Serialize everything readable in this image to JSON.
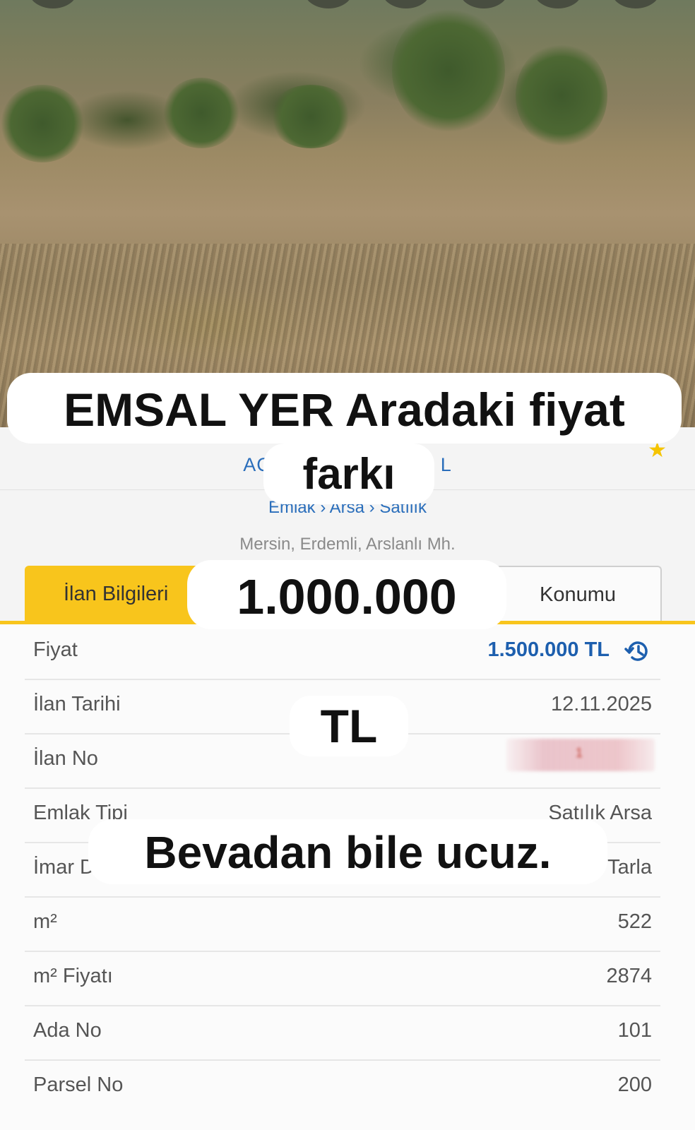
{
  "overlay": {
    "line1": "EMSAL YER Aradaki fiyat",
    "line2": "farkı",
    "line3": "1.000.000",
    "line4": "TL",
    "line5": "Bevadan bile ucuz."
  },
  "header": {
    "title_left": "AC",
    "title_right": "L",
    "star": "★",
    "breadcrumb": "Emlak › Arsa › Satılık",
    "location": "Mersin, Erdemli, Arslanlı Mh."
  },
  "tabs": {
    "info": "İlan Bilgileri",
    "location": "Konumu"
  },
  "rows": [
    {
      "key": "Fiyat",
      "value": "1.500.000 TL"
    },
    {
      "key": "İlan Tarihi",
      "value": "12.11.2025"
    },
    {
      "key": "İlan No",
      "value": "1"
    },
    {
      "key": "Emlak Tipi",
      "value": "Satılık Arsa"
    },
    {
      "key": "İmar Durumu",
      "value": "Tarla"
    },
    {
      "key": "m²",
      "value": "522"
    },
    {
      "key": "m² Fiyatı",
      "value": "2874"
    },
    {
      "key": "Ada No",
      "value": "101"
    },
    {
      "key": "Parsel No",
      "value": "200"
    }
  ],
  "colors": {
    "accent_yellow": "#f8c51c",
    "link_blue": "#2a6ebb",
    "price_blue": "#1d5fae"
  },
  "icons": {
    "price_history": "history-icon"
  }
}
